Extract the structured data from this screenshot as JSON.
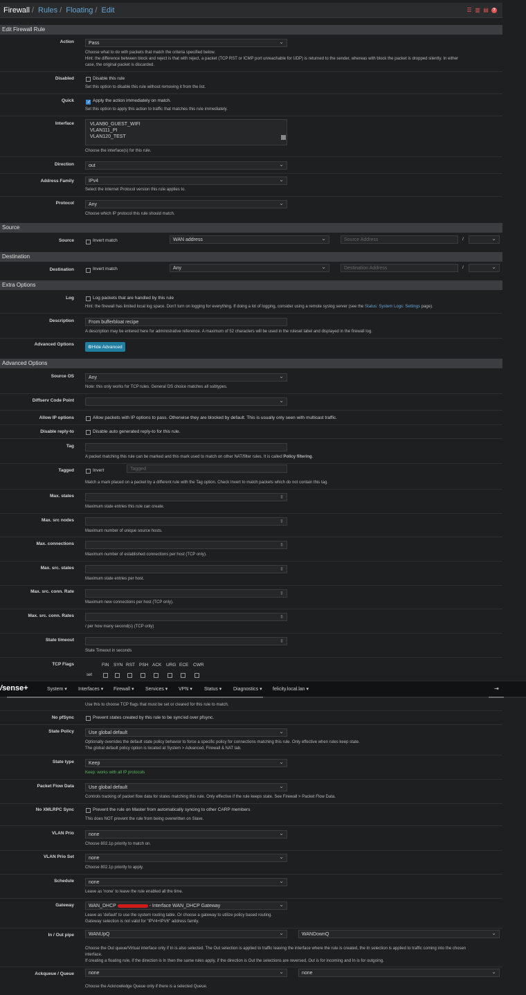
{
  "breadcrumb": {
    "root": "Firewall",
    "l1": "Rules",
    "l2": "Floating",
    "l3": "Edit"
  },
  "header_icons": [
    "sliders-icon",
    "chart-icon",
    "table-icon",
    "help-icon"
  ],
  "sections": {
    "edit": "Edit Firewall Rule",
    "source": "Source",
    "destination": "Destination",
    "extra": "Extra Options",
    "advanced": "Advanced Options"
  },
  "action": {
    "label": "Action",
    "value": "Pass",
    "hint1": "Choose what to do with packets that match the criteria specified below.",
    "hint2": "Hint: the difference between block and reject is that with reject, a packet (TCP RST or ICMP port unreachable for UDP) is returned to the sender, whereas with block the packet is dropped silently. In either",
    "hint3": "case, the original packet is discarded."
  },
  "disabled": {
    "label": "Disabled",
    "text": "Disable this rule",
    "hint": "Set this option to disable this rule without removing it from the list."
  },
  "quick": {
    "label": "Quick",
    "text": "Apply the action immediately on match.",
    "hint": "Set this option to apply this action to traffic that matches this rule immediately."
  },
  "interface": {
    "label": "Interface",
    "items": [
      "VLAN90_GUEST_WIFI",
      "VLAN111_PI",
      "VLAN120_TEST"
    ],
    "hint": "Choose the interface(s) for this rule."
  },
  "direction": {
    "label": "Direction",
    "value": "out"
  },
  "family": {
    "label": "Address Family",
    "value": "IPv4",
    "hint": "Select the Internet Protocol version this rule applies to."
  },
  "protocol": {
    "label": "Protocol",
    "value": "Any",
    "hint": "Choose which IP protocol this rule should match."
  },
  "source": {
    "label": "Source",
    "invert": "Invert match",
    "type": "WAN address",
    "addr_placeholder": "Source Address",
    "slash": "/"
  },
  "dest": {
    "label": "Destination",
    "invert": "Invert match",
    "type": "Any",
    "addr_placeholder": "Destination Address",
    "slash": "/"
  },
  "log": {
    "label": "Log",
    "text": "Log packets that are handled by this rule",
    "hint_a": "Hint: the firewall has limited local log space. Don't turn on logging for everything. If doing a lot of logging, consider using a remote syslog server (see the ",
    "hint_link": "Status: System Logs: Settings",
    "hint_b": " page)."
  },
  "description": {
    "label": "Description",
    "value": "From bufferbloat recipe",
    "hint": "A description may be entered here for administrative reference. A maximum of 52 characters will be used in the ruleset label and displayed in the firewall log."
  },
  "advbtn": {
    "label": "Advanced Options",
    "button": "Hide Advanced"
  },
  "sourceos": {
    "label": "Source OS",
    "value": "Any",
    "hint": "Note: this only works for TCP rules. General OS choice matches all subtypes."
  },
  "dscp": {
    "label": "Diffserv Code Point"
  },
  "ipopts": {
    "label": "Allow IP options",
    "text": "Allow packets with IP options to pass. Otherwise they are blocked by default. This is usually only seen with multicast traffic."
  },
  "replyto": {
    "label": "Disable reply-to",
    "text": "Disable auto generated reply-to for this rule."
  },
  "tag": {
    "label": "Tag",
    "hint_a": "A packet matching this rule can be marked and this mark used to match on other NAT/filter rules. It is called ",
    "hint_b": "Policy filtering",
    "hint_c": "."
  },
  "tagged": {
    "label": "Tagged",
    "invert": "Invert",
    "placeholder": "Tagged",
    "hint": "Match a mark placed on a packet by a different rule with the Tag option. Check Invert to match packets which do not contain this tag."
  },
  "maxstates": {
    "label": "Max. states",
    "hint": "Maximum state entries this rule can create."
  },
  "maxsrcnodes": {
    "label": "Max. src nodes",
    "hint": "Maximum number of unique source hosts."
  },
  "maxconn": {
    "label": "Max. connections",
    "hint": "Maximum number of established connections per host (TCP only)."
  },
  "maxsrcstates": {
    "label": "Max. src. states",
    "hint": "Maximum state entries per host."
  },
  "maxconnrate": {
    "label": "Max. src. conn. Rate",
    "hint": "Maximum new connections per host (TCP only)."
  },
  "maxconnrates": {
    "label": "Max. src. conn. Rates",
    "hint": "/ per how many second(s) (TCP only)"
  },
  "statetimeout": {
    "label": "State timeout",
    "hint": "State Timeout in seconds"
  },
  "tcpflags": {
    "label": "TCP Flags",
    "flags": [
      "FIN",
      "SYN",
      "RST",
      "PSH",
      "ACK",
      "URG",
      "ECE",
      "CWR"
    ],
    "set": "set",
    "hint": "Use this to choose TCP flags that must be set or cleared for this rule to match."
  },
  "nav": {
    "logo": "sense",
    "logo_plus": "+",
    "items": [
      "System",
      "Interfaces",
      "Firewall",
      "Services",
      "VPN",
      "Status",
      "Diagnostics",
      "felicity.local.lan"
    ]
  },
  "nopfsync": {
    "label": "No pfSync",
    "text": "Prevent states created by this rule to be sync'ed over pfsync."
  },
  "statepolicy": {
    "label": "State Policy",
    "value": "Use global default",
    "hint1": "Optionally overrides the default state policy behavior to force a specific policy for connections matching this rule. Only effective when rules keep state.",
    "hint2": "The global default policy option is located at System > Advanced, Firewall & NAT tab."
  },
  "statetype": {
    "label": "State type",
    "value": "Keep",
    "hint": "Keep: works with all IP protocols"
  },
  "pflow": {
    "label": "Packet Flow Data",
    "value": "Use global default",
    "hint": "Controls tracking of packet flow data for states matching this rule. Only effective if the rule keeps state. See Firewall > Packet Flow Data."
  },
  "noxmlrpc": {
    "label": "No XMLRPC Sync",
    "text": "Prevent the rule on Master from automatically syncing to other CARP members",
    "hint": "This does NOT prevent the rule from being overwritten on Slave."
  },
  "vlanprio": {
    "label": "VLAN Prio",
    "value": "none",
    "hint": "Choose 802.1p priority to match on."
  },
  "vlanprioset": {
    "label": "VLAN Prio Set",
    "value": "none",
    "hint": "Choose 802.1p priority to apply."
  },
  "schedule": {
    "label": "Schedule",
    "value": "none",
    "hint": "Leave as 'none' to leave the rule enabled all the time."
  },
  "gateway": {
    "label": "Gateway",
    "value_a": "WAN_DHCP",
    "value_b": "- Interface WAN_DHCP Gateway",
    "hint1": "Leave as 'default' to use the system routing table. Or choose a gateway to utilize policy based routing.",
    "hint2": "Gateway selection is not valid for \"IPV4+IPV6\" address family."
  },
  "pipe": {
    "label": "In / Out pipe",
    "in": "WANUpQ",
    "out": "WANDownQ",
    "hint1": "Choose the Out queue/Virtual interface only if In is also selected. The Out selection is applied to traffic leaving the interface where the rule is created, the In selection is applied to traffic coming into the chosen",
    "hint2": "interface.",
    "hint3": "If creating a floating rule, if the direction is In then the same rules apply, if the direction is Out the selections are reversed, Out is for incoming and In is for outgoing."
  },
  "ackqueue": {
    "label": "Ackqueue / Queue",
    "ack": "none",
    "queue": "none",
    "hint": "Choose the Acknowledge Queue only if there is a selected Queue."
  }
}
